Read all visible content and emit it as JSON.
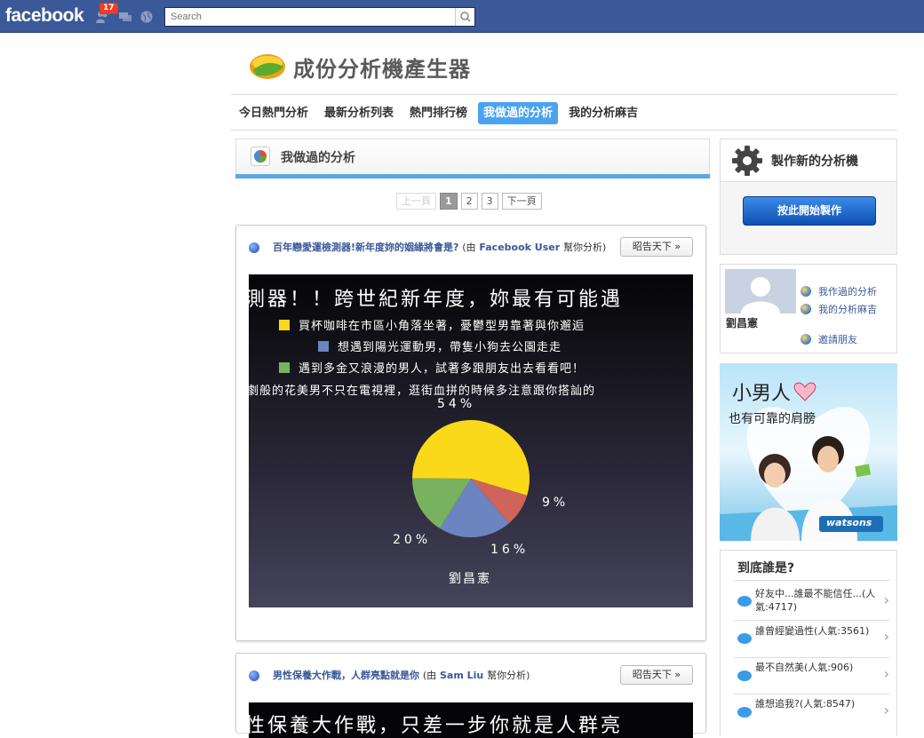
{
  "fbbar": {
    "logo": "facebook",
    "notification_count": "17",
    "search_placeholder": "Search",
    "colors": {
      "bar": "#3b5998",
      "badge": "#f03d25"
    }
  },
  "app": {
    "title": "成份分析機產生器",
    "tabs": [
      {
        "label": "今日熱門分析",
        "active": false
      },
      {
        "label": "最新分析列表",
        "active": false
      },
      {
        "label": "熱門排行榜",
        "active": false
      },
      {
        "label": "我做過的分析",
        "active": true
      },
      {
        "label": "我的分析麻吉",
        "active": false
      }
    ]
  },
  "main": {
    "section_title": "我做過的分析",
    "pager": {
      "prev": "上一頁",
      "pages": [
        "1",
        "2",
        "3"
      ],
      "current": "1",
      "next": "下一頁"
    },
    "posts": [
      {
        "title": "百年戀愛運檢測器!新年度妳的姻緣將會是?",
        "by_prefix": "(由",
        "user": "Facebook User",
        "by_suffix": "幫你分析)",
        "share_label": "昭告天下",
        "image": {
          "headline": "測器！！跨世紀新年度，妳最有可能遇",
          "legend": [
            {
              "label": "買杯咖啡在市區小角落坐著，憂鬱型男靠著與你邂逅",
              "color": "#f9d91a"
            },
            {
              "label": "想遇到陽光運動男，帶隻小狗去公園走走",
              "color": "#6c84bf"
            },
            {
              "label": "遇到多金又浪漫的男人，試著多跟朋友出去看看吧！",
              "color": "#78b25e"
            }
          ],
          "note": "劇般的花美男不只在電視裡，逛街血拼的時候多注意跟你搭訕的",
          "label_54": "54%",
          "label_9": "9%",
          "label_16": "16%",
          "label_20": "20%",
          "name": "劉昌憲"
        }
      },
      {
        "title": "男性保養大作戰，人群亮點就是你",
        "by_prefix": "(由",
        "user": "Sam Liu",
        "by_suffix": "幫你分析)",
        "share_label": "昭告天下",
        "image_text": "性保養大作戰，只差一步你就是人群亮"
      }
    ]
  },
  "chart_data": {
    "type": "pie",
    "categories": [
      "買杯咖啡在市區小角落坐著，憂鬱型男靠著與你邂逅",
      "遇到多金又浪漫的男人，試著多跟朋友出去看看吧！",
      "想遇到陽光運動男，帶隻小狗去公園走走",
      "red slice"
    ],
    "values": [
      54,
      16,
      20,
      9
    ],
    "colors": [
      "#f9d91a",
      "#78b25e",
      "#6c84bf",
      "#d0645a"
    ]
  },
  "sidebar": {
    "make_title": "製作新的分析機",
    "make_button": "按此開始製作",
    "profile": {
      "name": "劉昌憲",
      "links": [
        "我作過的分析",
        "我的分析麻吉",
        "邀請朋友"
      ]
    },
    "ad": {
      "headline": "小男人",
      "sub": "也有可靠的肩膀",
      "brand": "watsons"
    },
    "who": {
      "title": "到底誰是?",
      "items": [
        "好友中...誰最不能信任...(人氣:4717)",
        "誰曾經變過性(人氣:3561)",
        "最不自然美(人氣:906)",
        "誰想追我?(人氣:8547)"
      ]
    }
  }
}
